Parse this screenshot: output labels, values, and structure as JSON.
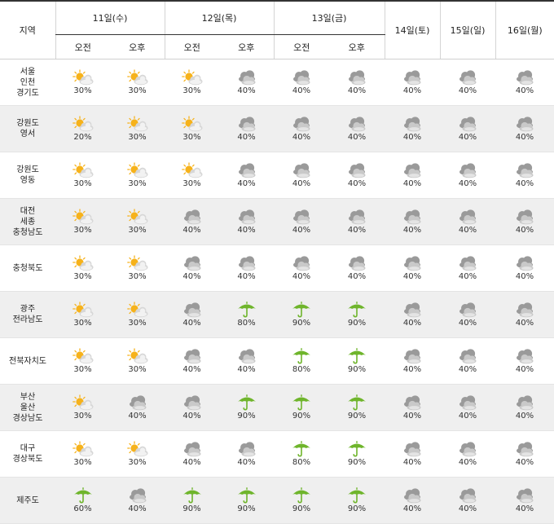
{
  "header": {
    "region_label": "지역",
    "days": [
      {
        "label": "11일(수)",
        "split": true
      },
      {
        "label": "12일(목)",
        "split": true
      },
      {
        "label": "13일(금)",
        "split": true
      },
      {
        "label": "14일(토)",
        "split": false
      },
      {
        "label": "15일(일)",
        "split": false
      },
      {
        "label": "16일(월)",
        "split": false
      }
    ],
    "am_label": "오전",
    "pm_label": "오후"
  },
  "rows": [
    {
      "region": [
        "서울",
        "인천",
        "경기도"
      ],
      "cells": [
        {
          "icon": "sun-cloud-icon",
          "pct": "30%"
        },
        {
          "icon": "sun-cloud-icon",
          "pct": "30%"
        },
        {
          "icon": "sun-cloud-icon",
          "pct": "30%"
        },
        {
          "icon": "cloud-icon",
          "pct": "40%"
        },
        {
          "icon": "cloud-icon",
          "pct": "40%"
        },
        {
          "icon": "cloud-icon",
          "pct": "40%"
        },
        {
          "icon": "cloud-icon",
          "pct": "40%"
        },
        {
          "icon": "cloud-icon",
          "pct": "40%"
        },
        {
          "icon": "cloud-icon",
          "pct": "40%"
        }
      ]
    },
    {
      "region": [
        "강원도",
        "영서"
      ],
      "cells": [
        {
          "icon": "sun-cloud-icon",
          "pct": "20%"
        },
        {
          "icon": "sun-cloud-icon",
          "pct": "30%"
        },
        {
          "icon": "sun-cloud-icon",
          "pct": "30%"
        },
        {
          "icon": "cloud-icon",
          "pct": "40%"
        },
        {
          "icon": "cloud-icon",
          "pct": "40%"
        },
        {
          "icon": "cloud-icon",
          "pct": "40%"
        },
        {
          "icon": "cloud-icon",
          "pct": "40%"
        },
        {
          "icon": "cloud-icon",
          "pct": "40%"
        },
        {
          "icon": "cloud-icon",
          "pct": "40%"
        }
      ]
    },
    {
      "region": [
        "강원도",
        "영동"
      ],
      "cells": [
        {
          "icon": "sun-cloud-icon",
          "pct": "30%"
        },
        {
          "icon": "sun-cloud-icon",
          "pct": "30%"
        },
        {
          "icon": "sun-cloud-icon",
          "pct": "30%"
        },
        {
          "icon": "cloud-icon",
          "pct": "40%"
        },
        {
          "icon": "cloud-icon",
          "pct": "40%"
        },
        {
          "icon": "cloud-icon",
          "pct": "40%"
        },
        {
          "icon": "cloud-icon",
          "pct": "40%"
        },
        {
          "icon": "cloud-icon",
          "pct": "40%"
        },
        {
          "icon": "cloud-icon",
          "pct": "40%"
        }
      ]
    },
    {
      "region": [
        "대전",
        "세종",
        "충청남도"
      ],
      "cells": [
        {
          "icon": "sun-cloud-icon",
          "pct": "30%"
        },
        {
          "icon": "sun-cloud-icon",
          "pct": "30%"
        },
        {
          "icon": "cloud-icon",
          "pct": "40%"
        },
        {
          "icon": "cloud-icon",
          "pct": "40%"
        },
        {
          "icon": "cloud-icon",
          "pct": "40%"
        },
        {
          "icon": "cloud-icon",
          "pct": "40%"
        },
        {
          "icon": "cloud-icon",
          "pct": "40%"
        },
        {
          "icon": "cloud-icon",
          "pct": "40%"
        },
        {
          "icon": "cloud-icon",
          "pct": "40%"
        }
      ]
    },
    {
      "region": [
        "충청북도"
      ],
      "cells": [
        {
          "icon": "sun-cloud-icon",
          "pct": "30%"
        },
        {
          "icon": "sun-cloud-icon",
          "pct": "30%"
        },
        {
          "icon": "cloud-icon",
          "pct": "40%"
        },
        {
          "icon": "cloud-icon",
          "pct": "40%"
        },
        {
          "icon": "cloud-icon",
          "pct": "40%"
        },
        {
          "icon": "cloud-icon",
          "pct": "40%"
        },
        {
          "icon": "cloud-icon",
          "pct": "40%"
        },
        {
          "icon": "cloud-icon",
          "pct": "40%"
        },
        {
          "icon": "cloud-icon",
          "pct": "40%"
        }
      ]
    },
    {
      "region": [
        "광주",
        "전라남도"
      ],
      "cells": [
        {
          "icon": "sun-cloud-icon",
          "pct": "30%"
        },
        {
          "icon": "sun-cloud-icon",
          "pct": "30%"
        },
        {
          "icon": "cloud-icon",
          "pct": "40%"
        },
        {
          "icon": "umbrella-icon",
          "pct": "80%"
        },
        {
          "icon": "umbrella-icon",
          "pct": "90%"
        },
        {
          "icon": "umbrella-icon",
          "pct": "90%"
        },
        {
          "icon": "cloud-icon",
          "pct": "40%"
        },
        {
          "icon": "cloud-icon",
          "pct": "40%"
        },
        {
          "icon": "cloud-icon",
          "pct": "40%"
        }
      ]
    },
    {
      "region": [
        "전북자치도"
      ],
      "cells": [
        {
          "icon": "sun-cloud-icon",
          "pct": "30%"
        },
        {
          "icon": "sun-cloud-icon",
          "pct": "30%"
        },
        {
          "icon": "cloud-icon",
          "pct": "40%"
        },
        {
          "icon": "cloud-icon",
          "pct": "40%"
        },
        {
          "icon": "umbrella-icon",
          "pct": "80%"
        },
        {
          "icon": "umbrella-icon",
          "pct": "90%"
        },
        {
          "icon": "cloud-icon",
          "pct": "40%"
        },
        {
          "icon": "cloud-icon",
          "pct": "40%"
        },
        {
          "icon": "cloud-icon",
          "pct": "40%"
        }
      ]
    },
    {
      "region": [
        "부산",
        "울산",
        "경상남도"
      ],
      "cells": [
        {
          "icon": "sun-cloud-icon",
          "pct": "30%"
        },
        {
          "icon": "cloud-icon",
          "pct": "40%"
        },
        {
          "icon": "cloud-icon",
          "pct": "40%"
        },
        {
          "icon": "umbrella-icon",
          "pct": "90%"
        },
        {
          "icon": "umbrella-icon",
          "pct": "90%"
        },
        {
          "icon": "umbrella-icon",
          "pct": "90%"
        },
        {
          "icon": "cloud-icon",
          "pct": "40%"
        },
        {
          "icon": "cloud-icon",
          "pct": "40%"
        },
        {
          "icon": "cloud-icon",
          "pct": "40%"
        }
      ]
    },
    {
      "region": [
        "대구",
        "경상북도"
      ],
      "cells": [
        {
          "icon": "sun-cloud-icon",
          "pct": "30%"
        },
        {
          "icon": "sun-cloud-icon",
          "pct": "30%"
        },
        {
          "icon": "cloud-icon",
          "pct": "40%"
        },
        {
          "icon": "cloud-icon",
          "pct": "40%"
        },
        {
          "icon": "umbrella-icon",
          "pct": "80%"
        },
        {
          "icon": "umbrella-icon",
          "pct": "90%"
        },
        {
          "icon": "cloud-icon",
          "pct": "40%"
        },
        {
          "icon": "cloud-icon",
          "pct": "40%"
        },
        {
          "icon": "cloud-icon",
          "pct": "40%"
        }
      ]
    },
    {
      "region": [
        "제주도"
      ],
      "cells": [
        {
          "icon": "umbrella-icon",
          "pct": "60%"
        },
        {
          "icon": "cloud-icon",
          "pct": "40%"
        },
        {
          "icon": "umbrella-icon",
          "pct": "90%"
        },
        {
          "icon": "umbrella-icon",
          "pct": "90%"
        },
        {
          "icon": "umbrella-icon",
          "pct": "90%"
        },
        {
          "icon": "umbrella-icon",
          "pct": "90%"
        },
        {
          "icon": "cloud-icon",
          "pct": "40%"
        },
        {
          "icon": "cloud-icon",
          "pct": "40%"
        },
        {
          "icon": "cloud-icon",
          "pct": "40%"
        }
      ]
    }
  ],
  "colors": {
    "sun": "#f6b21b",
    "cloud": "#a9a9a9",
    "umbrella": "#6fb52c"
  }
}
